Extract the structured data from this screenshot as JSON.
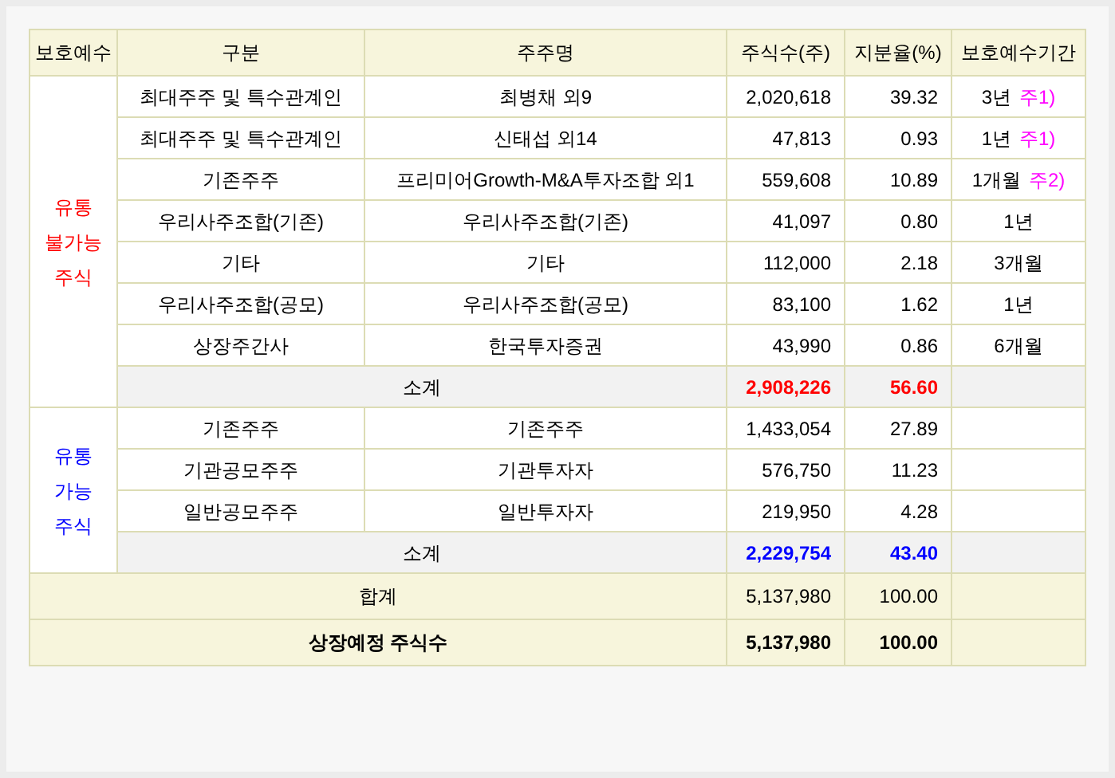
{
  "table": {
    "columns": [
      "보호예수",
      "구분",
      "주주명",
      "주식수(주)",
      "지분율(%)",
      "보호예수기간"
    ],
    "groups": [
      {
        "label_lines": [
          "유통",
          "불가능",
          "주식"
        ],
        "color": "#ff0000",
        "rows": [
          {
            "category": "최대주주 및 특수관계인",
            "holder": "최병채 외9",
            "shares": "2,020,618",
            "ratio": "39.32",
            "period": "3년",
            "note": "주1)"
          },
          {
            "category": "최대주주 및 특수관계인",
            "holder": "신태섭 외14",
            "shares": "47,813",
            "ratio": "0.93",
            "period": "1년",
            "note": "주1)"
          },
          {
            "category": "기존주주",
            "holder": "프리미어Growth-M&A투자조합 외1",
            "shares": "559,608",
            "ratio": "10.89",
            "period": "1개월",
            "note": "주2)"
          },
          {
            "category": "우리사주조합(기존)",
            "holder": "우리사주조합(기존)",
            "shares": "41,097",
            "ratio": "0.80",
            "period": "1년"
          },
          {
            "category": "기타",
            "holder": "기타",
            "shares": "112,000",
            "ratio": "2.18",
            "period": "3개월"
          },
          {
            "category": "우리사주조합(공모)",
            "holder": "우리사주조합(공모)",
            "shares": "83,100",
            "ratio": "1.62",
            "period": "1년"
          },
          {
            "category": "상장주간사",
            "holder": "한국투자증권",
            "shares": "43,990",
            "ratio": "0.86",
            "period": "6개월"
          }
        ],
        "subtotal": {
          "label": "소계",
          "shares": "2,908,226",
          "ratio": "56.60"
        }
      },
      {
        "label_lines": [
          "유통",
          "가능",
          "주식"
        ],
        "color": "#0000ff",
        "rows": [
          {
            "category": "기존주주",
            "holder": "기존주주",
            "shares": "1,433,054",
            "ratio": "27.89"
          },
          {
            "category": "기관공모주주",
            "holder": "기관투자자",
            "shares": "576,750",
            "ratio": "11.23"
          },
          {
            "category": "일반공모주주",
            "holder": "일반투자자",
            "shares": "219,950",
            "ratio": "4.28"
          }
        ],
        "subtotal": {
          "label": "소계",
          "shares": "2,229,754",
          "ratio": "43.40"
        }
      }
    ],
    "totals": [
      {
        "label": "합계",
        "shares": "5,137,980",
        "ratio": "100.00",
        "bold": false
      },
      {
        "label": "상장예정 주식수",
        "shares": "5,137,980",
        "ratio": "100.00",
        "bold": true
      }
    ]
  }
}
